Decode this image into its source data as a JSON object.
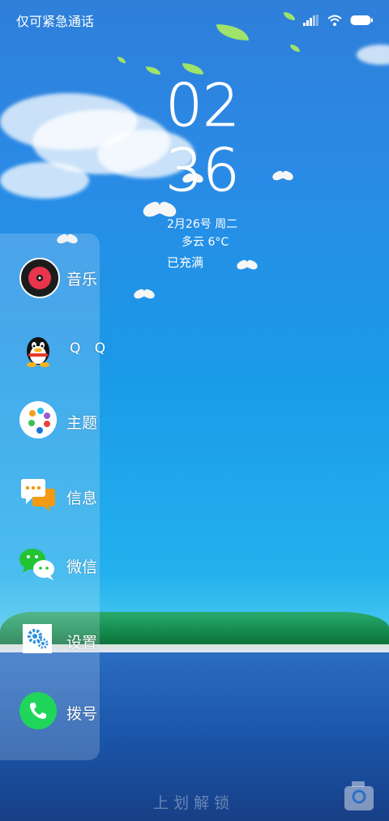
{
  "status_bar": {
    "carrier": "仅可紧急通话",
    "icons": [
      "signal-icon",
      "wifi-icon",
      "battery-icon"
    ]
  },
  "lockscreen": {
    "hour": "02",
    "minute": "36",
    "date": "2月26号 周二",
    "weather": "多云 6°C",
    "charging": "已充满",
    "unlock_hint": "上划解锁"
  },
  "dock": {
    "items": [
      {
        "label": "音乐",
        "icon": "music-icon"
      },
      {
        "label": "Q Q",
        "icon": "qq-icon"
      },
      {
        "label": "主题",
        "icon": "theme-palette-icon"
      },
      {
        "label": "信息",
        "icon": "message-icon"
      },
      {
        "label": "微信",
        "icon": "wechat-icon"
      },
      {
        "label": "设置",
        "icon": "settings-icon"
      },
      {
        "label": "拨号",
        "icon": "phone-icon"
      }
    ]
  },
  "colors": {
    "music": "#e8344c",
    "phone": "#1fd65a",
    "wechat": "#22c433",
    "message": "#f29a12",
    "settings": "#2d8ee0"
  }
}
